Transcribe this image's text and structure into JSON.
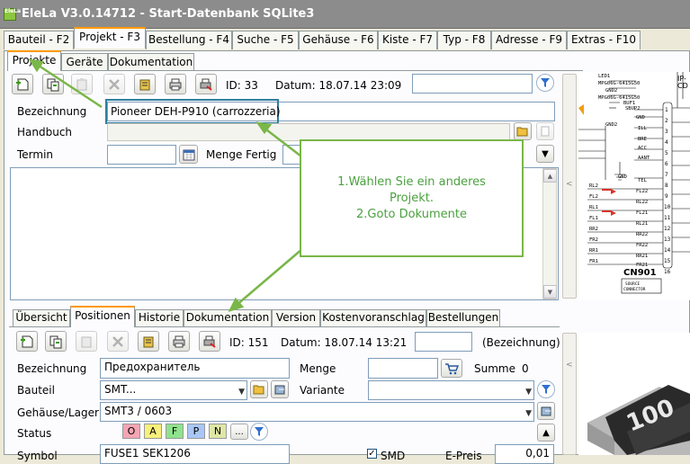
{
  "window": {
    "title": "EleLa V3.0.14712  - Start-Datenbank SQLite3",
    "app_icon_text": "EleLa"
  },
  "main_tabs": [
    "Bauteil - F2",
    "Projekt - F3",
    "Bestellung - F4",
    "Suche - F5",
    "Gehäuse - F6",
    "Kiste - F7",
    "Typ - F8",
    "Adresse - F9",
    "Extras - F10"
  ],
  "sub_tabs": [
    "Projekte",
    "Geräte",
    "Dokumentation"
  ],
  "project": {
    "id_label": "ID: 33",
    "datum_label": "Datum: 18.07.14 23:09",
    "bezeichnung_label": "Bezeichnung",
    "bezeichnung_value": "Pioneer DEH-P910 (carrozzeria)",
    "handbuch_label": "Handbuch",
    "termin_label": "Termin",
    "menge_fertig_label": "Menge Fertig"
  },
  "callout": {
    "line1": "1.Wählen Sie ein anderes",
    "line2": "Projekt.",
    "line3": "2.Goto Dokumente"
  },
  "bottom_tabs": [
    "Übersicht",
    "Positionen",
    "Historie",
    "Dokumentation",
    "Version",
    "Kostenvoranschlag",
    "Bestellungen"
  ],
  "position": {
    "id_label": "ID: 151",
    "datum_label": "Datum: 18.07.14 13:21",
    "bezeichnung_hint": "(Bezeichnung)",
    "bezeichnung_label": "Bezeichnung",
    "bezeichnung_value": "Предохранитель",
    "menge_label": "Menge",
    "summe_label": "Summe",
    "summe_value": "0",
    "bauteil_label": "Bauteil",
    "bauteil_value": "SMT...",
    "variante_label": "Variante",
    "gehaeuse_label": "Gehäuse/Lager",
    "gehaeuse_value": "SMT3 / 0603",
    "status_label": "Status",
    "status_chips": [
      "O",
      "A",
      "F",
      "P",
      "N"
    ],
    "status_more": "...",
    "symbol_label": "Symbol",
    "symbol_value": "FUSE1 SEK1206",
    "smd_label": "SMD",
    "e_preis_label": "E-Preis",
    "e_preis_value": "0,01"
  },
  "schematic": {
    "top_labels": [
      "LED1",
      "MPG06G-6415G50",
      "GND2",
      "MPG06G-6415G50",
      "BUF1",
      "SBUP2"
    ],
    "pin_labels": [
      "GND",
      "ILL",
      "BRE",
      "ACC",
      "AANT",
      "TEL",
      "FL22",
      "FL21",
      "RL22",
      "RL21",
      "RR22",
      "FR22",
      "FR21"
    ],
    "left_labels": [
      "GND2",
      "RL2",
      "FL2",
      "RL1",
      "FL1",
      "RR2",
      "FR2",
      "RR1",
      "FR1"
    ],
    "pin_numbers": [
      "1",
      "2",
      "3",
      "4",
      "5",
      "6",
      "7",
      "8",
      "9",
      "10",
      "11",
      "12",
      "13",
      "14",
      "15",
      "16"
    ],
    "connector_label": "CN901",
    "source_label": "SOURCE CONNECTOR",
    "ip_label": "IP-",
    "cd_label": "CD"
  },
  "component_image": {
    "marking": "100"
  },
  "colors": {
    "callout_border": "#7ab648",
    "callout_text": "#4ba13f",
    "highlight_box": "#2f7f9e",
    "tab_active": "#ff9a00"
  }
}
